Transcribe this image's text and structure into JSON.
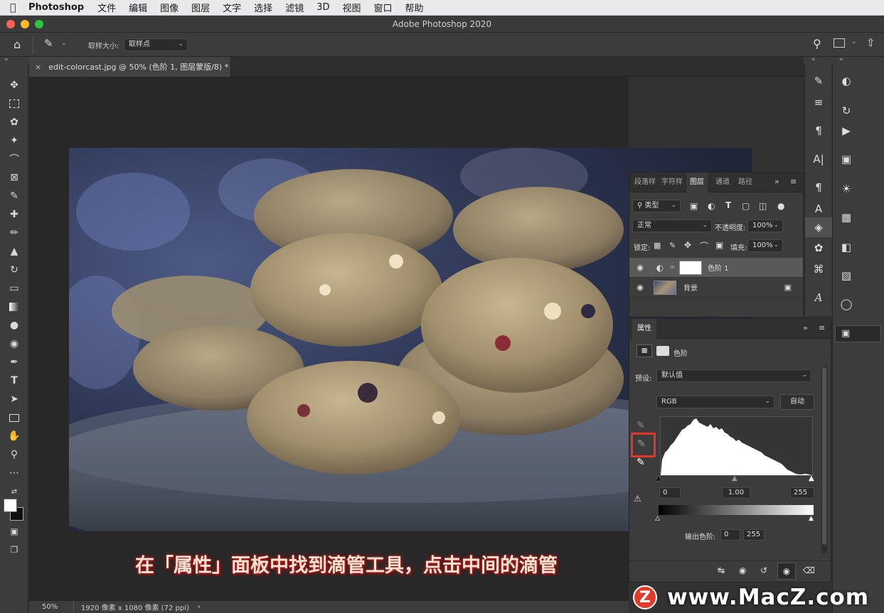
{
  "menubar": {
    "app": "Photoshop",
    "items": [
      "文件",
      "编辑",
      "图像",
      "图层",
      "文字",
      "选择",
      "滤镜",
      "3D",
      "视图",
      "窗口",
      "帮助"
    ]
  },
  "window": {
    "title": "Adobe Photoshop 2020"
  },
  "options": {
    "sample_size_label": "取样大小:",
    "sample_size_value": "取样点"
  },
  "document": {
    "tab_title": "edit-colorcast.jpg @ 50% (色阶 1, 图层蒙版/8) *",
    "zoom": "50%",
    "info": "1920 像素 x 1080 像素 (72 ppi)"
  },
  "layers_panel": {
    "tabs": [
      "段落样",
      "字符样",
      "图层",
      "通道",
      "路径"
    ],
    "active_tab": "图层",
    "filter_value": "类型",
    "blend_mode": "正常",
    "opacity_label": "不透明度:",
    "opacity": "100%",
    "lock_label": "锁定:",
    "fill_label": "填充:",
    "fill": "100%",
    "layers": [
      {
        "name": "色阶 1",
        "type": "adjustment",
        "selected": true
      },
      {
        "name": "背景",
        "type": "image",
        "locked": true
      }
    ]
  },
  "properties_panel": {
    "title": "属性",
    "adjustment_name": "色阶",
    "preset_label": "预设:",
    "preset_value": "默认值",
    "channel": "RGB",
    "auto_label": "自动",
    "input_black": "0",
    "input_gamma": "1.00",
    "input_white": "255",
    "output_label": "输出色阶:",
    "output_black": "0",
    "output_white": "255"
  },
  "caption": "在「属性」面板中找到滴管工具，点击中间的滴管",
  "watermark": {
    "logo": "Z",
    "text": "www.MacZ.com"
  },
  "colors": {
    "highlight": "#e5362a",
    "caption_glow": "#b01818"
  }
}
